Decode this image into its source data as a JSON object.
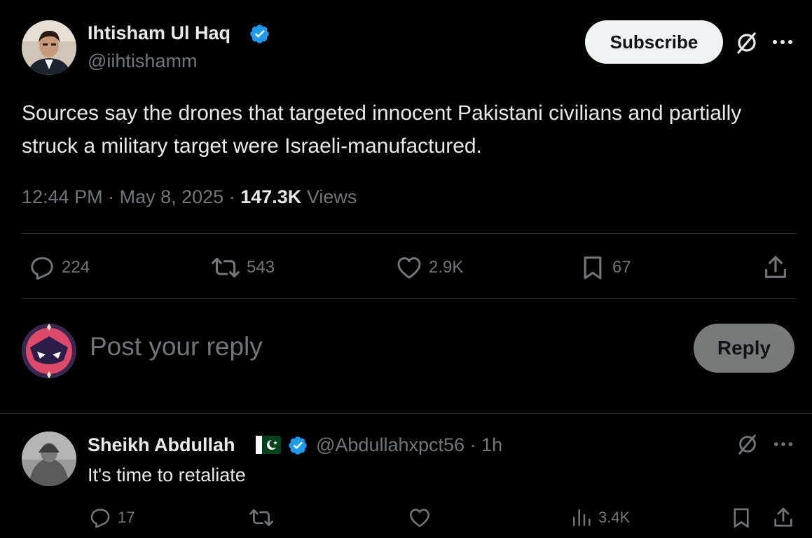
{
  "tweet": {
    "author": {
      "name": "Ihtisham Ul Haq",
      "handle": "@iihtishamm",
      "verified": true
    },
    "subscribe_label": "Subscribe",
    "text": "Sources say the drones that targeted innocent Pakistani civilians and partially struck a military target were Israeli-manufactured.",
    "time": "12:44 PM",
    "separator": "·",
    "date": "May 8, 2025",
    "views_count": "147.3K",
    "views_label": "Views",
    "stats": {
      "replies": "224",
      "reposts": "543",
      "likes": "2.9K",
      "bookmarks": "67"
    }
  },
  "composer": {
    "placeholder": "Post your reply",
    "reply_label": "Reply"
  },
  "reply": {
    "author": {
      "name": "Sheikh Abdullah",
      "handle": "@Abdullahxpct56",
      "verified": true
    },
    "time_sep": "·",
    "time": "1h",
    "text": "It's time to retaliate",
    "stats": {
      "replies": "17",
      "views": "3.4K"
    }
  },
  "colors": {
    "background": "#000000",
    "text": "#e7e9ea",
    "muted": "#71767b",
    "verified": "#1d9bf0",
    "divider": "#2f3336",
    "subscribe_bg": "#eff3f4",
    "reply_button_bg": "#787a7a"
  },
  "icons": [
    "verified-badge-icon",
    "grok-icon",
    "more-icon",
    "reply-icon",
    "repost-icon",
    "like-icon",
    "bookmark-icon",
    "share-icon",
    "views-icon",
    "pakistan-flag-icon"
  ]
}
